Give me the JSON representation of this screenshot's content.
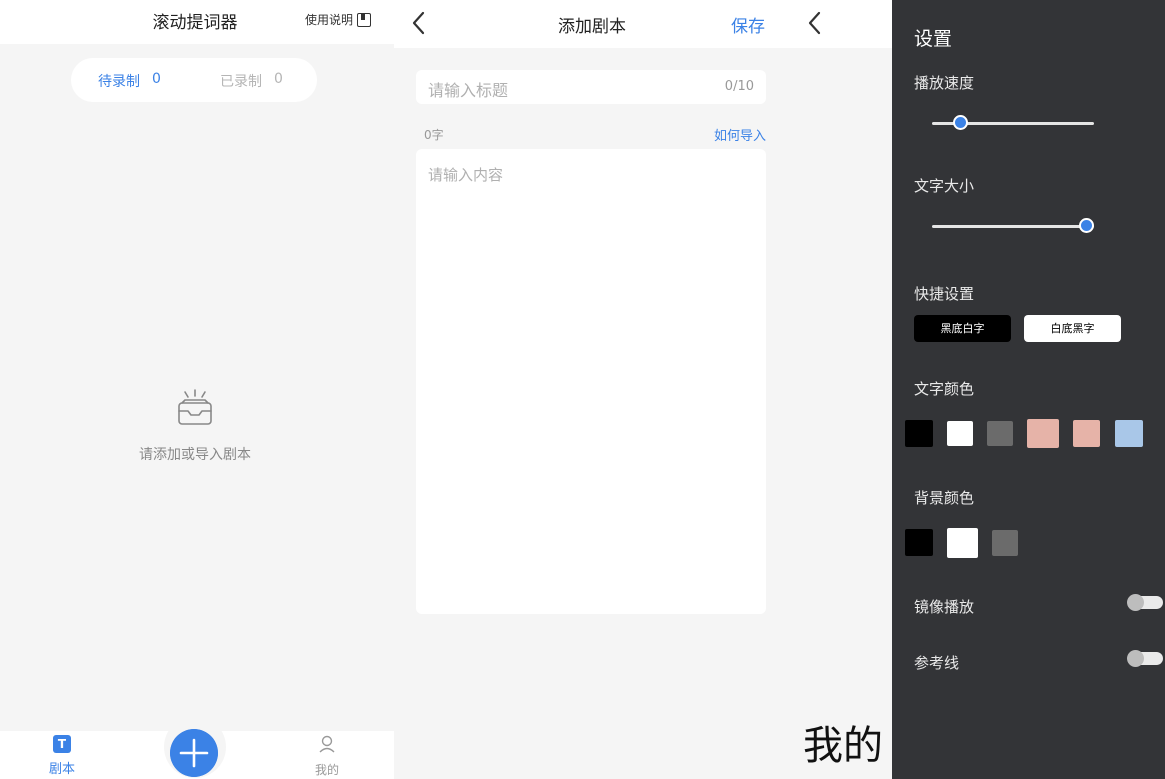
{
  "list_screen": {
    "title": "滚动提词器",
    "help_label": "使用说明",
    "tabs": [
      {
        "label": "待录制",
        "count": "0"
      },
      {
        "label": "已录制",
        "count": "0"
      }
    ],
    "empty_text": "请添加或导入剧本",
    "bottom_nav": {
      "script_label": "剧本",
      "script_icon_letter": "T",
      "me_label": "我的"
    }
  },
  "add_screen": {
    "title": "添加剧本",
    "save_label": "保存",
    "title_placeholder": "请输入标题",
    "title_count": "0/10",
    "char_count": "0字",
    "how_import": "如何导入",
    "content_placeholder": "请输入内容"
  },
  "settings_screen": {
    "me_label": "我的",
    "title": "设置",
    "speed_label": "播放速度",
    "speed_value": 0.14,
    "font_size_label": "文字大小",
    "font_size_value": 1.0,
    "quick_label": "快捷设置",
    "presets": [
      "黑底白字",
      "白底黑字"
    ],
    "text_color_label": "文字颜色",
    "text_colors": [
      "#000000",
      "#ffffff",
      "#6b6b6b",
      "#e6b3a8",
      "#e6b3a8",
      "#a9c7e8"
    ],
    "bg_color_label": "背景颜色",
    "bg_colors": [
      "#000000",
      "#ffffff",
      "#6b6b6b"
    ],
    "mirror_label": "镜像播放",
    "mirror_on": false,
    "guide_label": "参考线",
    "guide_on": false
  },
  "colors": {
    "accent": "#3b82e6",
    "drawer_bg": "#333437"
  }
}
